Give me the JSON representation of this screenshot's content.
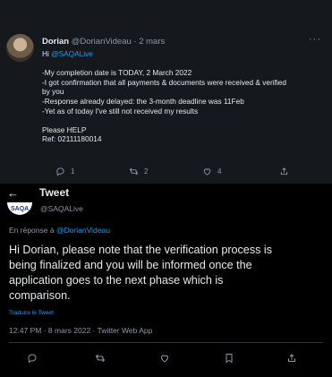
{
  "original_tweet": {
    "display_name": "Dorian",
    "handle": "@DorianVideau",
    "date": "· 2 mars",
    "more_label": "···",
    "mention": "@SAQALive",
    "greeting": "Hi ",
    "lines": [
      "-My completion date is TODAY, 2 March 2022",
      "-I got confirmation that all payments & documents were received & verified",
      "by you",
      "-Response already delayed: the 3-month deadline was 11Feb",
      "-Yet as of today I've still not received my results",
      "",
      "Please HELP",
      "Ref: 02111180014"
    ],
    "counts": {
      "replies": "1",
      "retweets": "2",
      "likes": "4"
    }
  },
  "detail_header": {
    "back_label": "←",
    "title": "Tweet"
  },
  "reply_tweet": {
    "avatar_text": "SAQA",
    "handle": "@SAQALive",
    "replying_prefix": "En réponse à ",
    "replying_to": "@DorianVideau",
    "lines": [
      "Hi Dorian, please note that the verification process is",
      "being finalized and you will be informed once the",
      "application goes to the next phase which is",
      "comparison."
    ],
    "translate_label": "Traduire le Tweet",
    "meta": "12:47 PM · 8 mars 2022 · Twitter Web App"
  },
  "colors": {
    "accent": "#1d9bf0",
    "muted": "#8b98a5",
    "text": "#e7e9ea",
    "background": "#000000"
  }
}
